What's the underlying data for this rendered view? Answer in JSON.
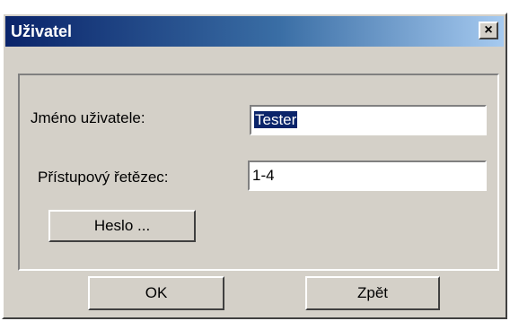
{
  "window": {
    "title": "Uživatel",
    "close_glyph": "×"
  },
  "form": {
    "username_label": "Jméno uživatele:",
    "username_value": "Tester",
    "access_label": "Přístupový řetězec:",
    "access_value": "1-4",
    "password_button": "Heslo ..."
  },
  "buttons": {
    "ok": "OK",
    "back": "Zpět"
  },
  "colors": {
    "titlebar_start": "#0a246a",
    "titlebar_end": "#a6caf0",
    "dialog_face": "#d4d0c8",
    "selection": "#0a246a"
  }
}
